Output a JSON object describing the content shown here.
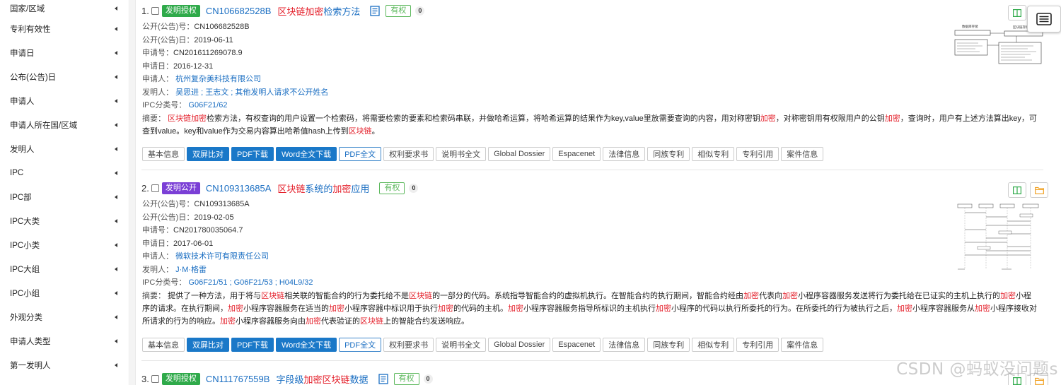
{
  "colors": {
    "grant_badge": "#2faa4a",
    "publication_badge": "#7b3fd6",
    "link": "#1a6ec2",
    "highlight": "#e4202b",
    "status_green": "#5cb85c",
    "button_blue": "#1a78c8"
  },
  "sidebar": {
    "items": [
      {
        "label": "国家/区域",
        "icon": "caret-left-icon"
      },
      {
        "label": "专利有效性",
        "icon": "caret-left-icon"
      },
      {
        "label": "申请日",
        "icon": "caret-left-icon"
      },
      {
        "label": "公布(公告)日",
        "icon": "caret-left-icon"
      },
      {
        "label": "申请人",
        "icon": "caret-left-icon"
      },
      {
        "label": "申请人所在国/区域",
        "icon": "caret-left-icon"
      },
      {
        "label": "发明人",
        "icon": "caret-left-icon"
      },
      {
        "label": "IPC",
        "icon": "caret-left-icon"
      },
      {
        "label": "IPC部",
        "icon": "caret-left-icon"
      },
      {
        "label": "IPC大类",
        "icon": "caret-left-icon"
      },
      {
        "label": "IPC小类",
        "icon": "caret-left-icon"
      },
      {
        "label": "IPC大组",
        "icon": "caret-left-icon"
      },
      {
        "label": "IPC小组",
        "icon": "caret-left-icon"
      },
      {
        "label": "外观分类",
        "icon": "caret-left-icon"
      },
      {
        "label": "申请人类型",
        "icon": "caret-left-icon"
      },
      {
        "label": "第一发明人",
        "icon": "caret-left-icon"
      }
    ]
  },
  "labels": {
    "pub_no": "公开(公告)号：",
    "pub_date": "公开(公告)日：",
    "app_no": "申请号：",
    "app_date": "申请日：",
    "applicant": "申请人：",
    "inventor": "发明人：",
    "ipc": "IPC分类号：",
    "abstract": "摘要："
  },
  "buttons": [
    "基本信息",
    "双屏比对",
    "PDF下载",
    "Word全文下载",
    "PDF全文",
    "权利要求书",
    "说明书全文",
    "Global Dossier",
    "Espacenet",
    "法律信息",
    "同族专利",
    "相似专利",
    "专利引用",
    "案件信息"
  ],
  "results": [
    {
      "index": "1.",
      "type": "发明授权",
      "pub_no": "CN106682528B",
      "title": [
        "区块链",
        "加密",
        "检索方法"
      ],
      "status": "有权",
      "count": "0",
      "pub_date": "2019-06-11",
      "app_no": "CN201611269078.9",
      "app_date": "2016-12-31",
      "applicant": "杭州复杂美科技有限公司",
      "inventor": "吴思进 ; 王志文 ; 其他发明人请求不公开姓名",
      "ipc": "G06F21/62",
      "abstract": [
        {
          "t": "区块链",
          "h": true
        },
        {
          "t": "加密",
          "h": true
        },
        {
          "t": "检索方法，有权查询的用户设置一个检索码，将需要检索的要素和检索码串联，并做哈希运算，将哈希运算的结果作为key,value里放需要查询的内容，用对称密钥",
          "h": false
        },
        {
          "t": "加密",
          "h": true
        },
        {
          "t": "，对称密钥用有权限用户的公钥",
          "h": false
        },
        {
          "t": "加密",
          "h": true
        },
        {
          "t": "，查询时，用户有上述方法算出key，可查到value。key和value作为交易内容算出哈希值hash上传到",
          "h": false
        },
        {
          "t": "区块链",
          "h": true
        },
        {
          "t": "。",
          "h": false
        }
      ]
    },
    {
      "index": "2.",
      "type": "发明公开",
      "pub_no": "CN109313685A",
      "title": [
        "区块链",
        "系统的",
        "加密",
        "应用"
      ],
      "status": "有权",
      "count": "0",
      "pub_date": "2019-02-05",
      "app_no": "CN201780035064.7",
      "app_date": "2017-06-01",
      "applicant": "微软技术许可有限责任公司",
      "inventor": "J·M·格雷",
      "ipc": "G06F21/51 ; G06F21/53 ; H04L9/32",
      "abstract": [
        {
          "t": "提供了一种方法，用于将与",
          "h": false
        },
        {
          "t": "区块链",
          "h": true
        },
        {
          "t": "相关联的智能合约的行为委托给不是",
          "h": false
        },
        {
          "t": "区块链",
          "h": true
        },
        {
          "t": "的一部分的代码。系统指导智能合约的虚拟机执行。在智能合约的执行期间，智能合约经由",
          "h": false
        },
        {
          "t": "加密",
          "h": true
        },
        {
          "t": "代表向",
          "h": false
        },
        {
          "t": "加密",
          "h": true
        },
        {
          "t": "小程序容器服务发送将行为委托给在已证实的主机上执行的",
          "h": false
        },
        {
          "t": "加密",
          "h": true
        },
        {
          "t": "小程序的请求。在执行期间，",
          "h": false
        },
        {
          "t": "加密",
          "h": true
        },
        {
          "t": "小程序容器服务在适当的",
          "h": false
        },
        {
          "t": "加密",
          "h": true
        },
        {
          "t": "小程序容器中标识用于执行",
          "h": false
        },
        {
          "t": "加密",
          "h": true
        },
        {
          "t": "的代码的主机。",
          "h": false
        },
        {
          "t": "加密",
          "h": true
        },
        {
          "t": "小程序容器服务指导所标识的主机执行",
          "h": false
        },
        {
          "t": "加密",
          "h": true
        },
        {
          "t": "小程序的代码以执行所委托的行为。在所委托的行为被执行之后，",
          "h": false
        },
        {
          "t": "加密",
          "h": true
        },
        {
          "t": "小程序容器服务从",
          "h": false
        },
        {
          "t": "加密",
          "h": true
        },
        {
          "t": "小程序接收对所请求的行为的响应。",
          "h": false
        },
        {
          "t": "加密",
          "h": true
        },
        {
          "t": "小程序容器服务向由",
          "h": false
        },
        {
          "t": "加密",
          "h": true
        },
        {
          "t": "代表验证的",
          "h": false
        },
        {
          "t": "区块链",
          "h": true
        },
        {
          "t": "上的智能合约发送响应。",
          "h": false
        }
      ]
    },
    {
      "index": "3.",
      "type": "发明授权",
      "pub_no": "CN111767559B",
      "title": [
        "字段级",
        "加密",
        "区块链",
        "数据"
      ],
      "status": "有权",
      "count": "0"
    }
  ],
  "thumbnail_texts": [
    "数据库存储",
    "区块链存储"
  ],
  "watermark": "CSDN @蚂蚁没问题s"
}
